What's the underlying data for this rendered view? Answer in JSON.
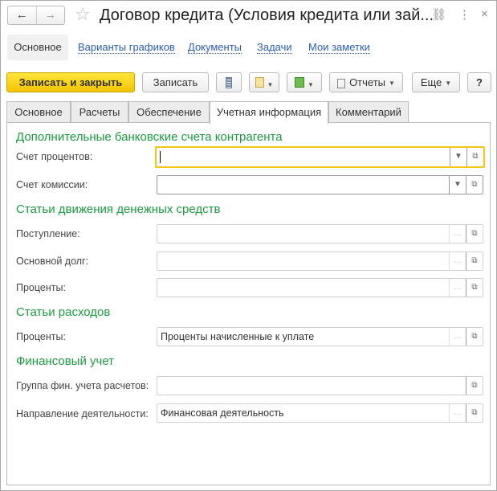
{
  "window": {
    "title": "Договор кредита (Условия кредита или зай...",
    "back": "←",
    "forward": "→",
    "star": "☆",
    "link_icon": "⛓",
    "more_icon": "⋮",
    "close_icon": "×"
  },
  "nav": {
    "items": [
      "Основное",
      "Варианты графиков",
      "Документы",
      "Задачи",
      "Мои заметки"
    ]
  },
  "toolbar": {
    "save_close": "Записать и закрыть",
    "save": "Записать",
    "reports": "Отчеты",
    "more": "Еще",
    "help": "?"
  },
  "tabs": [
    "Основное",
    "Расчеты",
    "Обеспечение",
    "Учетная информация",
    "Комментарий"
  ],
  "sections": {
    "bank": {
      "title": "Дополнительные банковские счета контрагента",
      "interest_label": "Счет процентов:",
      "interest_value": "",
      "commission_label": "Счет комиссии:",
      "commission_value": ""
    },
    "cash": {
      "title": "Статьи движения денежных средств",
      "receipt_label": "Поступление:",
      "principal_label": "Основной долг:",
      "interest_label": "Проценты:"
    },
    "expenses": {
      "title": "Статьи расходов",
      "interest_label": "Проценты:",
      "interest_value": "Проценты начисленные к уплате"
    },
    "finance": {
      "title": "Финансовый учет",
      "group_label": "Группа фин. учета расчетов:",
      "group_value": "",
      "direction_label": "Направление деятельности:",
      "direction_value": "Финансовая деятельность"
    }
  }
}
